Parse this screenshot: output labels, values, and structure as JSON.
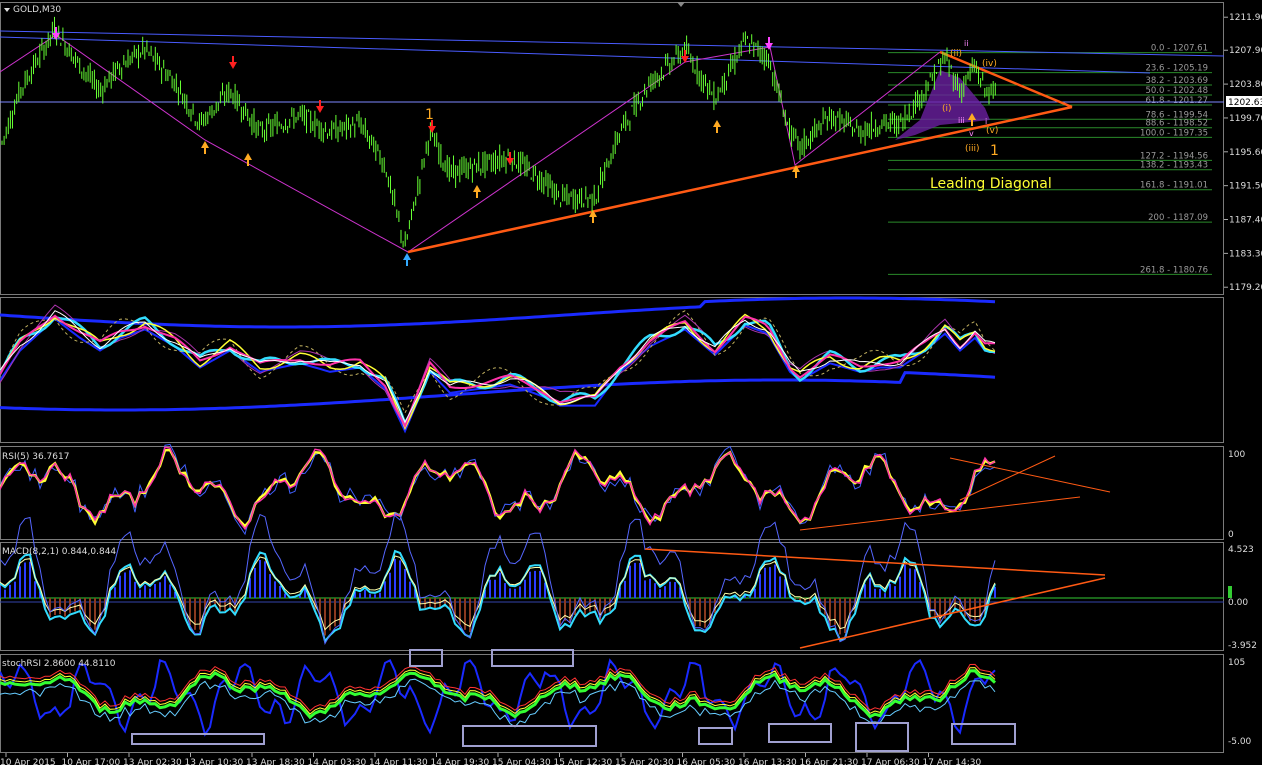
{
  "window": {
    "symbol_title": "GOLD,M30"
  },
  "main_panel": {
    "price_axis": [
      "1211.90",
      "1207.90",
      "1203.80",
      "1199.70",
      "1195.60",
      "1191.50",
      "1187.40",
      "1183.30",
      "1179.20"
    ],
    "current_price": "1202.63",
    "price_range": [
      1178.5,
      1213.5
    ],
    "annotations": {
      "wave_1_left": "1",
      "wave_1_right": "1",
      "leading_diagonal": "Leading Diagonal",
      "wave_i": "(i)",
      "wave_ii": "(ii)",
      "wave_iii": "(iii)",
      "wave_iv": "(iv)",
      "wave_v": "(v)",
      "sub_iii": "iii",
      "sub_v": "v",
      "sub_ii": "ii",
      "sub_i": "i"
    },
    "fib_levels": [
      {
        "label": "0.0 - 1207.61",
        "price": 1207.61
      },
      {
        "label": "23.6 - 1205.19",
        "price": 1205.19
      },
      {
        "label": "38.2 - 1203.69",
        "price": 1203.69
      },
      {
        "label": "50.0 - 1202.48",
        "price": 1202.48
      },
      {
        "label": "61.8 - 1201.27",
        "price": 1201.27
      },
      {
        "label": "78.6 - 1199.54",
        "price": 1199.54
      },
      {
        "label": "88.6 - 1198.52",
        "price": 1198.52
      },
      {
        "label": "100.0 - 1197.35",
        "price": 1197.35
      },
      {
        "label": "127.2 - 1194.56",
        "price": 1194.56
      },
      {
        "label": "138.2 - 1193.43",
        "price": 1193.43
      },
      {
        "label": "161.8 - 1191.01",
        "price": 1191.01
      },
      {
        "label": "200 - 1187.09",
        "price": 1187.09
      },
      {
        "label": "261.8 - 1180.76",
        "price": 1180.76
      }
    ]
  },
  "rsi_panel": {
    "title": "RSI(5) 36.7617",
    "axis": [
      "100",
      "0"
    ]
  },
  "macd_panel": {
    "title": "MACD(8,2,1) 0.844,0.844",
    "axis": [
      "4.523",
      "0.00",
      "-3.952"
    ]
  },
  "stoch_panel": {
    "title": "stochRSI 2.8600 44.8110",
    "axis": [
      "105",
      "-5.00"
    ]
  },
  "time_axis": [
    "10 Apr 2015",
    "10 Apr 17:00",
    "13 Apr 02:30",
    "13 Apr 10:30",
    "13 Apr 18:30",
    "14 Apr 03:30",
    "14 Apr 11:30",
    "14 Apr 19:30",
    "15 Apr 04:30",
    "15 Apr 12:30",
    "15 Apr 20:30",
    "16 Apr 05:30",
    "16 Apr 13:30",
    "16 Apr 21:30",
    "17 Apr 06:30",
    "17 Apr 14:30"
  ],
  "colors": {
    "candle": "#66ff33",
    "support": "#ff5a14",
    "blue_line": "#4a5cff",
    "magenta": "#cc33cc",
    "cyan": "#33ddff",
    "yellow": "#ffff33",
    "pink": "#ff33aa",
    "fib": "#2a8a2a"
  }
}
